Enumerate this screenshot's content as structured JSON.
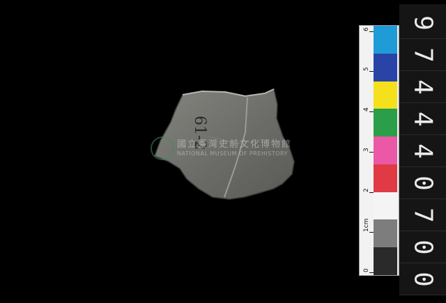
{
  "scale_bar": {
    "numbers": [
      "0",
      "1cm",
      "2",
      "3",
      "4",
      "5",
      "6"
    ],
    "patches": [
      "#2a2a2a",
      "#7d7d7d",
      "#f4f4f4",
      "#e03a44",
      "#ea58a6",
      "#2a9e49",
      "#f4e01c",
      "#2943a7",
      "#1f9cd6"
    ]
  },
  "catalog_number": [
    "0",
    "0",
    "7",
    "0",
    "4",
    "4",
    "4",
    "7",
    "9"
  ],
  "watermark": {
    "chinese": "國立臺灣史前文化博物館",
    "english": "NATIONAL MUSEUM OF PREHISTORY"
  },
  "artifact": {
    "inscription": "61-2",
    "stone_color": "#6f6f6c"
  }
}
